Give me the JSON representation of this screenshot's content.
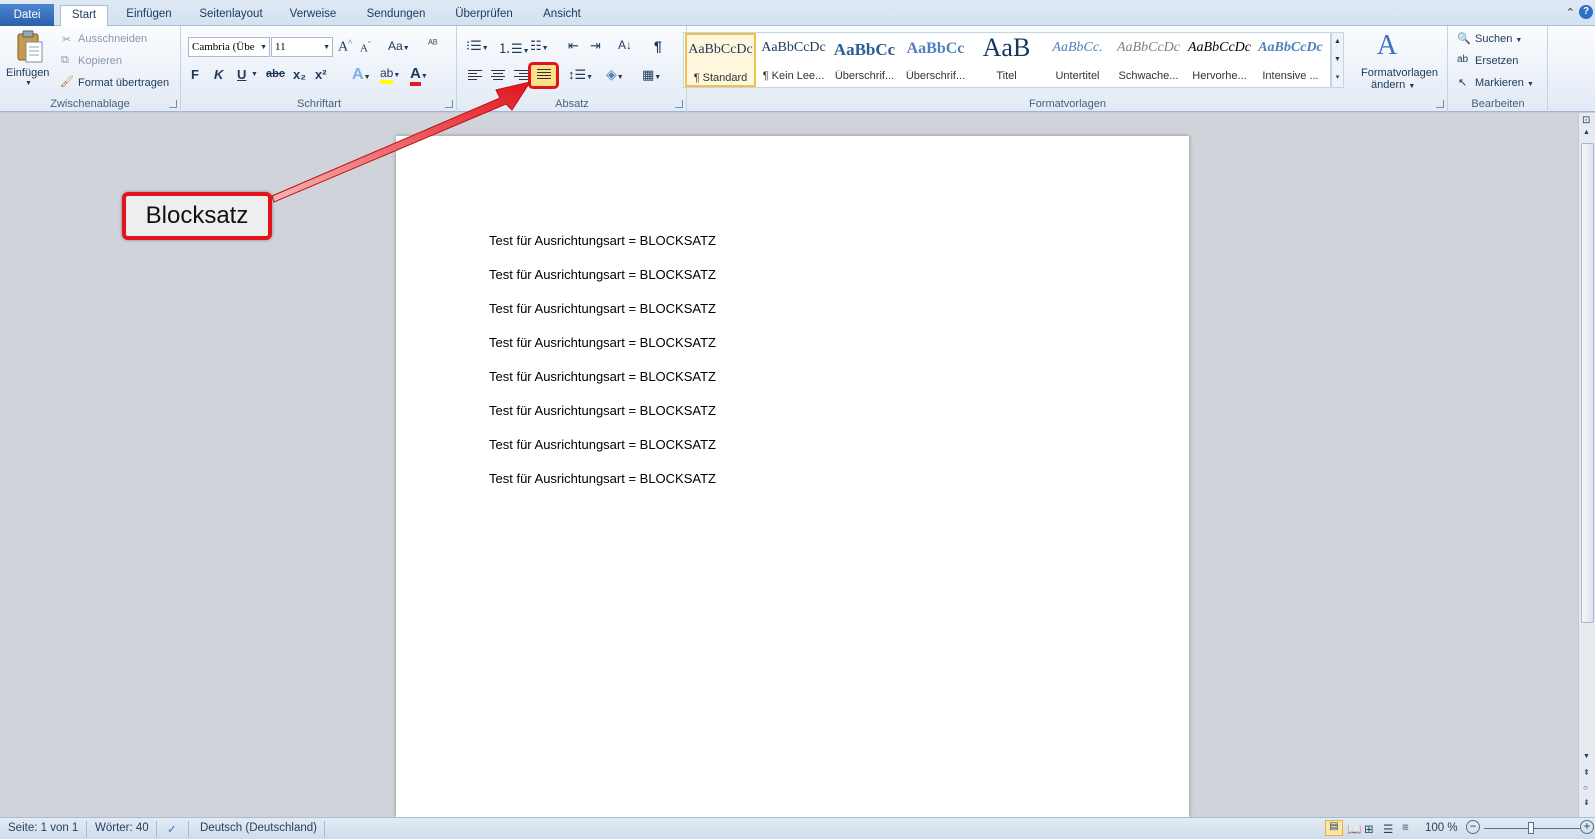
{
  "tabs": [
    "Datei",
    "Start",
    "Einfügen",
    "Seitenlayout",
    "Verweise",
    "Sendungen",
    "Überprüfen",
    "Ansicht"
  ],
  "active_tab": "Start",
  "clipboard": {
    "paste": "Einfügen",
    "cut": "Ausschneiden",
    "copy": "Kopieren",
    "format_painter": "Format übertragen",
    "label": "Zwischenablage"
  },
  "font": {
    "name": "Cambria (Übe",
    "size": "11",
    "label": "Schriftart",
    "bold": "F",
    "italic": "K",
    "underline": "U",
    "strike": "abc",
    "sub": "x₂",
    "sup": "x²",
    "grow": "A",
    "shrink": "A",
    "case": "Aa",
    "color_accent": "#e01b1b",
    "highlight_accent": "#ffff00"
  },
  "paragraph": {
    "label": "Absatz",
    "pilcrow": "¶",
    "sort": "A↓"
  },
  "styles": {
    "label": "Formatvorlagen",
    "items": [
      {
        "preview": "AaBbCcDc",
        "name": "¶ Standard",
        "color": "#000000"
      },
      {
        "preview": "AaBbCcDc",
        "name": "¶ Kein Lee...",
        "color": "#000000"
      },
      {
        "preview": "AaBbCc",
        "name": "Überschrif...",
        "color": "#2d5d96"
      },
      {
        "preview": "AaBbCc",
        "name": "Überschrif...",
        "color": "#4f81bd"
      },
      {
        "preview": "AaB",
        "name": "Titel",
        "color": "#17365d"
      },
      {
        "preview": "AaBbCc.",
        "name": "Untertitel",
        "color": "#4f81bd"
      },
      {
        "preview": "AaBbCcDc",
        "name": "Schwache...",
        "color": "#808080"
      },
      {
        "preview": "AaBbCcDc",
        "name": "Hervorhe...",
        "color": "#000000"
      },
      {
        "preview": "AaBbCcDc",
        "name": "Intensive ...",
        "color": "#4f81bd"
      }
    ],
    "change_line1": "Formatvorlagen",
    "change_line2": "ändern"
  },
  "editing": {
    "label": "Bearbeiten",
    "find": "Suchen",
    "replace": "Ersetzen",
    "select": "Markieren"
  },
  "document": {
    "lines": [
      "Test für Ausrichtungsart = BLOCKSATZ",
      "Test für Ausrichtungsart = BLOCKSATZ",
      "Test für Ausrichtungsart = BLOCKSATZ",
      "Test für Ausrichtungsart = BLOCKSATZ",
      "Test für Ausrichtungsart = BLOCKSATZ",
      "Test für Ausrichtungsart = BLOCKSATZ",
      "Test für Ausrichtungsart = BLOCKSATZ",
      "Test für Ausrichtungsart = BLOCKSATZ"
    ]
  },
  "status": {
    "page": "Seite: 1 von 1",
    "words": "Wörter: 40",
    "language": "Deutsch (Deutschland)",
    "zoom": "100 %"
  },
  "annotation": {
    "callout": "Blocksatz",
    "color": "#e1141b"
  }
}
